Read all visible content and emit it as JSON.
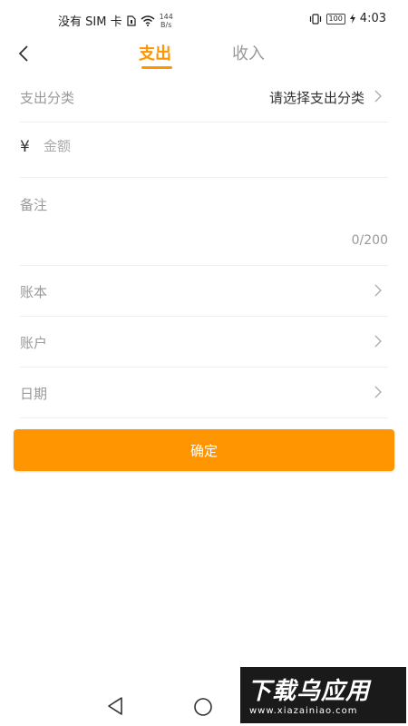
{
  "status_bar": {
    "carrier": "没有 SIM 卡",
    "net_speed_value": "144",
    "net_speed_unit": "B/s",
    "battery": "100",
    "time": "4:03"
  },
  "header": {
    "tabs": [
      {
        "label": "支出",
        "active": true
      },
      {
        "label": "收入",
        "active": false
      }
    ],
    "accent_color": "#ff9500"
  },
  "form": {
    "category": {
      "label": "支出分类",
      "value": "请选择支出分类"
    },
    "amount": {
      "currency": "¥",
      "placeholder": "金额"
    },
    "note": {
      "label": "备注",
      "counter": "0/200"
    },
    "ledger": {
      "label": "账本"
    },
    "account": {
      "label": "账户"
    },
    "date": {
      "label": "日期"
    }
  },
  "confirm_button": {
    "label": "确定"
  },
  "watermark": {
    "text": "下载乌应用",
    "url": "www.xiazainiao.com"
  }
}
